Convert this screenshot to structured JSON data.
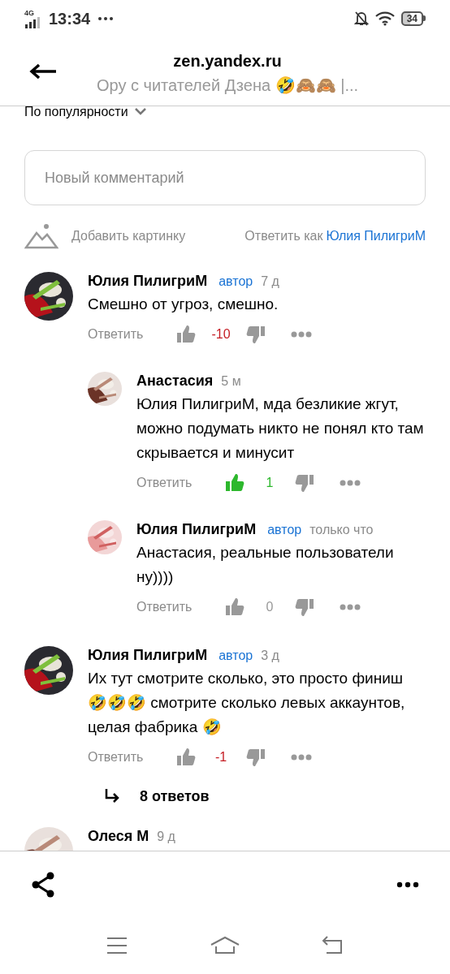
{
  "status_bar": {
    "network": "4G",
    "time": "13:34",
    "battery": "34"
  },
  "header": {
    "domain": "zen.yandex.ru",
    "title": "Ору с читателей Дзена 🤣🙈🙈 |..."
  },
  "sort": {
    "label": "По популярности"
  },
  "composer": {
    "placeholder": "Новый комментарий",
    "add_image": "Добавить картинку",
    "reply_as_label": "Ответить как",
    "reply_as_name": "Юлия ПилигриМ"
  },
  "comments": [
    {
      "author": "Юлия ПилигриМ",
      "badge": "автор",
      "time": "7 д",
      "text": "Смешно от угроз, смешно.",
      "reply": "Ответить",
      "liked": false,
      "score": {
        "text": "-10",
        "color": "#c51d24"
      },
      "children": [
        {
          "author": "Анастасия",
          "time": "5 м",
          "text": "Юлия ПилигриМ, мда безликие жгут, можно подумать никто не понял кто там скрывается и минусит",
          "reply": "Ответить",
          "liked": true,
          "score": {
            "text": "1",
            "color": "#2db82d"
          }
        },
        {
          "author": "Юлия ПилигриМ",
          "badge": "автор",
          "time": "только что",
          "text": "Анастасия, реальные пользователи ну))))",
          "reply": "Ответить",
          "liked": false,
          "score": {
            "text": "0",
            "color": "#999999"
          }
        }
      ]
    },
    {
      "author": "Юлия ПилигриМ",
      "badge": "автор",
      "time": "3 д",
      "text": "Их тут смотрите сколько, это просто финиш 🤣🤣🤣 смотрите сколько левых аккаунтов, целая фабрика 🤣",
      "reply": "Ответить",
      "liked": false,
      "score": {
        "text": "-1",
        "color": "#c51d24"
      },
      "replies_link": "8 ответов"
    },
    {
      "author": "Олеся М",
      "time": "9 д"
    }
  ]
}
